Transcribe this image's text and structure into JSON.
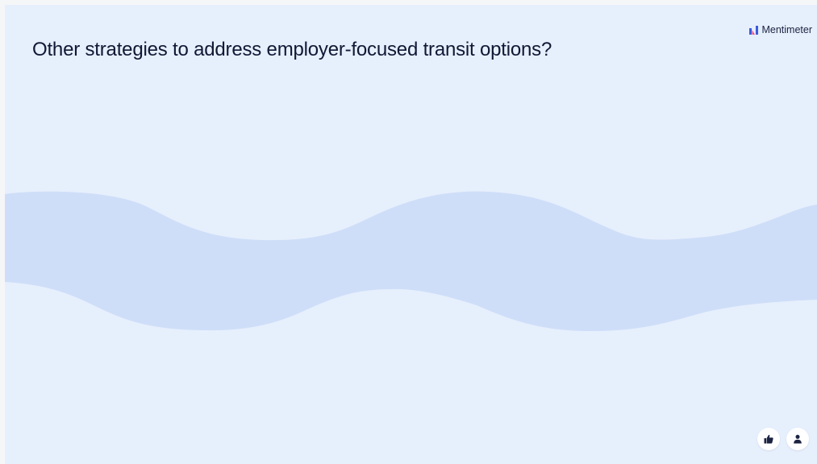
{
  "slide": {
    "question": "Other strategies to address employer-focused transit options?"
  },
  "brand": {
    "name": "Mentimeter",
    "icon": "mentimeter-logo-icon"
  },
  "controls": {
    "like_icon": "thumbs-up-icon",
    "profile_icon": "person-icon"
  },
  "colors": {
    "background": "#e6effc",
    "wave": "#cfdef8",
    "title_text": "#101834",
    "logo_blue": "#3b5bdb",
    "logo_pink": "#e8558e"
  }
}
